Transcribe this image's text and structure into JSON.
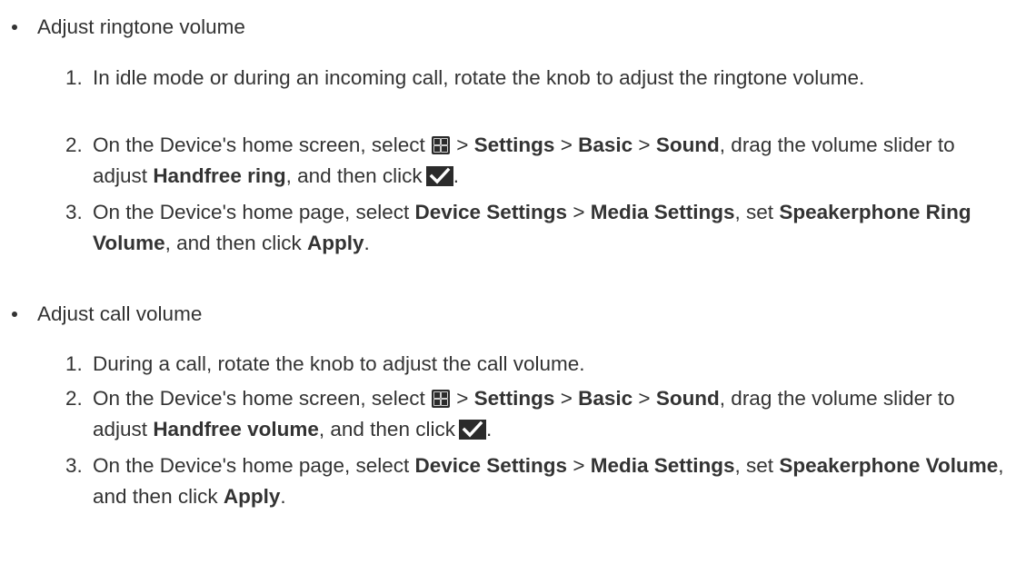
{
  "sections": [
    {
      "bullet": "Adjust ringtone volume",
      "steps": [
        {
          "num": "1.",
          "text": "In idle mode or during an incoming call, rotate the knob to adjust the ringtone volume."
        },
        {
          "num": "2.",
          "prefix": "On the Device's home screen, select",
          "sep1": ">",
          "settings": "Settings",
          "sep2": ">",
          "basic": "Basic",
          "sep3": ">",
          "sound": "Sound",
          "mid": ", drag the volume slider to adjust",
          "target": "Handfree ring",
          "suffix": ", and then click",
          "end": "."
        },
        {
          "num": "3.",
          "prefix": "On the Device's home page, select",
          "menu1": "Device Settings",
          "sep": ">",
          "menu2": "Media Settings",
          "mid": ", set",
          "field": "Speakerphone Ring Volume",
          "suffix": ", and then click",
          "button": "Apply",
          "end": "."
        }
      ]
    },
    {
      "bullet": "Adjust call volume",
      "steps": [
        {
          "num": "1.",
          "text": "During a call, rotate the knob to adjust the call volume."
        },
        {
          "num": "2.",
          "prefix": "On the Device's home screen, select",
          "sep1": ">",
          "settings": "Settings",
          "sep2": ">",
          "basic": "Basic",
          "sep3": ">",
          "sound": "Sound",
          "mid": ", drag the volume slider to adjust",
          "target": "Handfree volume",
          "suffix": ", and then click",
          "end": "."
        },
        {
          "num": "3.",
          "prefix": "On the Device's home page, select",
          "menu1": "Device Settings",
          "sep": ">",
          "menu2": "Media Settings",
          "mid": ", set",
          "field": "Speakerphone Volume",
          "suffix": ", and then click",
          "button": "Apply",
          "end": "."
        }
      ]
    }
  ],
  "icons": {
    "menu": "grid-menu-icon",
    "confirm": "checkmark-icon"
  },
  "colors": {
    "text": "#333333",
    "icon_bg": "#2b2b2b",
    "icon_fg": "#ffffff"
  }
}
